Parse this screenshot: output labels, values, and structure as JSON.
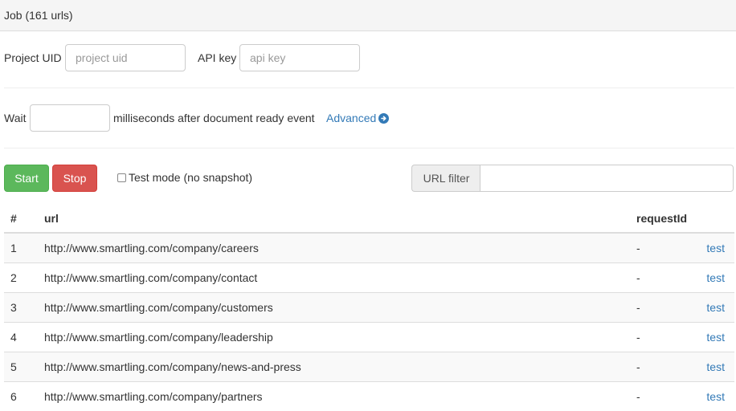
{
  "header": {
    "title": "Job (161 urls)"
  },
  "credentials": {
    "project_uid_label": "Project UID",
    "project_uid_placeholder": "project uid",
    "api_key_label": "API key",
    "api_key_placeholder": "api key"
  },
  "wait": {
    "wait_label": "Wait",
    "wait_value": "",
    "suffix_label": "milliseconds after document ready event",
    "advanced_label": "Advanced"
  },
  "controls": {
    "start_label": "Start",
    "stop_label": "Stop",
    "test_mode_label": "Test mode (no snapshot)",
    "url_filter_label": "URL filter",
    "url_filter_value": ""
  },
  "table": {
    "columns": [
      "#",
      "url",
      "requestId",
      ""
    ],
    "rows": [
      {
        "num": "1",
        "url": "http://www.smartling.com/company/careers",
        "request_id": "-",
        "action": "test"
      },
      {
        "num": "2",
        "url": "http://www.smartling.com/company/contact",
        "request_id": "-",
        "action": "test"
      },
      {
        "num": "3",
        "url": "http://www.smartling.com/company/customers",
        "request_id": "-",
        "action": "test"
      },
      {
        "num": "4",
        "url": "http://www.smartling.com/company/leadership",
        "request_id": "-",
        "action": "test"
      },
      {
        "num": "5",
        "url": "http://www.smartling.com/company/news-and-press",
        "request_id": "-",
        "action": "test"
      },
      {
        "num": "6",
        "url": "http://www.smartling.com/company/partners",
        "request_id": "-",
        "action": "test"
      }
    ]
  },
  "colors": {
    "start": "#5cb85c",
    "stop": "#d9534f",
    "link": "#337ab7"
  },
  "icons": {
    "advanced": "arrow-circle-right-icon"
  }
}
